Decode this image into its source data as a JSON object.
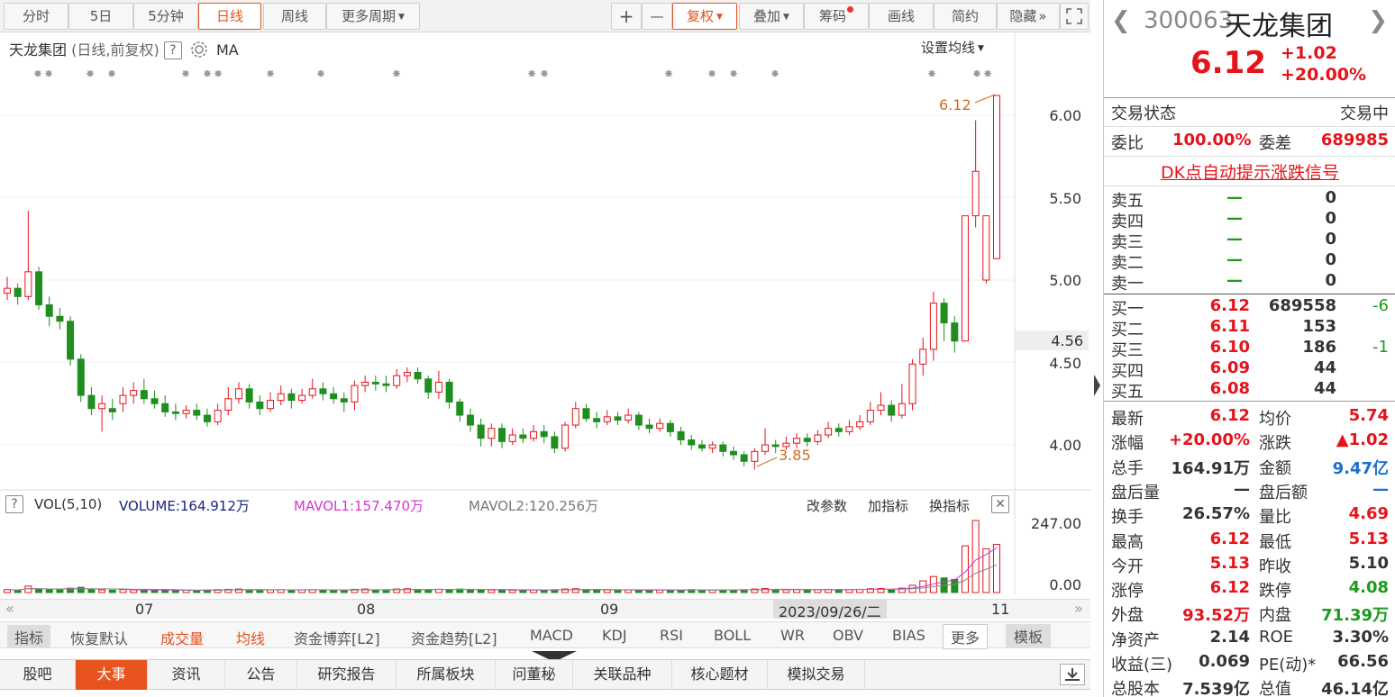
{
  "toolbar": {
    "periods": [
      "分时",
      "5日",
      "5分钟",
      "日线",
      "周线",
      "更多周期"
    ],
    "plus": "+",
    "minus": "—",
    "fuquan": "复权",
    "overlay": "叠加",
    "chips": "筹码",
    "draw": "画线",
    "simple": "简约",
    "hide": "隐藏",
    "hide_arrow": "»"
  },
  "chart": {
    "title": "天龙集团",
    "subtitle": "(日线,前复权)",
    "help": "?",
    "ma_label": "MA",
    "set_ma": "设置均线",
    "price_ticks": [
      "6.00",
      "5.50",
      "5.00",
      "4.50",
      "4.00"
    ],
    "current_price_tag": "4.56",
    "high_label": "6.12",
    "low_label": "3.85",
    "x_labels": [
      "07",
      "08",
      "09",
      "11"
    ],
    "date_tag": "2023/09/26/二",
    "vol_ticks": [
      "247.00",
      "0.00"
    ]
  },
  "indicator": {
    "help": "?",
    "name": "VOL(5,10)",
    "volume": "VOLUME:164.912万",
    "mavol1": "MAVOL1:157.470万",
    "mavol2": "MAVOL2:120.256万",
    "change_param": "改参数",
    "add_ind": "加指标",
    "swap_ind": "换指标",
    "close": "✕"
  },
  "ind_tabs": [
    "指标",
    "恢复默认",
    "成交量",
    "均线",
    "资金博弈[L2]",
    "资金趋势[L2]",
    "MACD",
    "KDJ",
    "RSI",
    "BOLL",
    "WR",
    "OBV",
    "BIAS",
    "更多",
    "模板"
  ],
  "bottom_tabs": [
    "股吧",
    "大事",
    "资讯",
    "公告",
    "研究报告",
    "所属板块",
    "问董秘",
    "关联品种",
    "核心题材",
    "模拟交易"
  ],
  "quote": {
    "code": "300063",
    "name": "天龙集团",
    "price": "6.12",
    "change": "+1.02",
    "change_pct": "+20.00%",
    "status_label": "交易状态",
    "status_value": "交易中",
    "weibi_label": "委比",
    "weibi_value": "100.00%",
    "weicha_label": "委差",
    "weicha_value": "689985",
    "dk_signal": "DK点自动提示涨跌信号",
    "asks": [
      {
        "label": "卖五",
        "price": "—",
        "vol": "0"
      },
      {
        "label": "卖四",
        "price": "—",
        "vol": "0"
      },
      {
        "label": "卖三",
        "price": "—",
        "vol": "0"
      },
      {
        "label": "卖二",
        "price": "—",
        "vol": "0"
      },
      {
        "label": "卖一",
        "price": "—",
        "vol": "0"
      }
    ],
    "bids": [
      {
        "label": "买一",
        "price": "6.12",
        "vol": "689558",
        "delta": "-6"
      },
      {
        "label": "买二",
        "price": "6.11",
        "vol": "153",
        "delta": ""
      },
      {
        "label": "买三",
        "price": "6.10",
        "vol": "186",
        "delta": "-1"
      },
      {
        "label": "买四",
        "price": "6.09",
        "vol": "44",
        "delta": ""
      },
      {
        "label": "买五",
        "price": "6.08",
        "vol": "44",
        "delta": ""
      }
    ],
    "stats": [
      {
        "l1": "最新",
        "v1": "6.12",
        "c1": "red",
        "l2": "均价",
        "v2": "5.74",
        "c2": "red"
      },
      {
        "l1": "涨幅",
        "v1": "+20.00%",
        "c1": "red",
        "l2": "涨跌",
        "v2": "▲1.02",
        "c2": "red"
      },
      {
        "l1": "总手",
        "v1": "164.91万",
        "c1": "",
        "l2": "金额",
        "v2": "9.47亿",
        "c2": "blu"
      },
      {
        "l1": "盘后量",
        "v1": "—",
        "c1": "",
        "l2": "盘后额",
        "v2": "—",
        "c2": "blu"
      },
      {
        "l1": "换手",
        "v1": "26.57%",
        "c1": "",
        "l2": "量比",
        "v2": "4.69",
        "c2": "red"
      },
      {
        "l1": "最高",
        "v1": "6.12",
        "c1": "red",
        "l2": "最低",
        "v2": "5.13",
        "c2": "red"
      },
      {
        "l1": "今开",
        "v1": "5.13",
        "c1": "red",
        "l2": "昨收",
        "v2": "5.10",
        "c2": ""
      },
      {
        "l1": "涨停",
        "v1": "6.12",
        "c1": "red",
        "l2": "跌停",
        "v2": "4.08",
        "c2": "grn"
      },
      {
        "l1": "外盘",
        "v1": "93.52万",
        "c1": "red",
        "l2": "内盘",
        "v2": "71.39万",
        "c2": "grn"
      },
      {
        "l1": "净资产",
        "v1": "2.14",
        "c1": "",
        "l2": "ROE",
        "v2": "3.30%",
        "c2": ""
      },
      {
        "l1": "收益(三)",
        "v1": "0.069",
        "c1": "",
        "l2": "PE(动)*",
        "v2": "66.56",
        "c2": ""
      },
      {
        "l1": "总股本",
        "v1": "7.539亿",
        "c1": "",
        "l2": "总值",
        "v2": "46.14亿",
        "c2": ""
      }
    ]
  },
  "colors": {
    "up": "#e5141b",
    "down": "#1f8e1f",
    "accent": "#e8541e"
  },
  "chart_data": {
    "type": "candlestick",
    "title": "天龙集团",
    "price_range": [
      3.7,
      6.4
    ],
    "candles": [
      [
        4.92,
        4.95,
        5.02,
        4.88
      ],
      [
        4.95,
        4.9,
        4.98,
        4.85
      ],
      [
        4.9,
        5.05,
        5.42,
        4.88
      ],
      [
        5.05,
        4.85,
        5.08,
        4.82
      ],
      [
        4.85,
        4.78,
        4.9,
        4.72
      ],
      [
        4.78,
        4.75,
        4.83,
        4.7
      ],
      [
        4.75,
        4.52,
        4.78,
        4.48
      ],
      [
        4.52,
        4.3,
        4.55,
        4.26
      ],
      [
        4.3,
        4.22,
        4.35,
        4.18
      ],
      [
        4.22,
        4.25,
        4.3,
        4.08
      ],
      [
        4.22,
        4.2,
        4.28,
        4.15
      ],
      [
        4.25,
        4.3,
        4.35,
        4.2
      ],
      [
        4.3,
        4.33,
        4.38,
        4.25
      ],
      [
        4.33,
        4.28,
        4.4,
        4.25
      ],
      [
        4.28,
        4.25,
        4.33,
        4.22
      ],
      [
        4.25,
        4.2,
        4.3,
        4.17
      ],
      [
        4.2,
        4.19,
        4.25,
        4.15
      ],
      [
        4.19,
        4.21,
        4.24,
        4.16
      ],
      [
        4.21,
        4.18,
        4.25,
        4.15
      ],
      [
        4.18,
        4.14,
        4.22,
        4.11
      ],
      [
        4.14,
        4.21,
        4.25,
        4.12
      ],
      [
        4.21,
        4.28,
        4.35,
        4.18
      ],
      [
        4.28,
        4.34,
        4.38,
        4.25
      ],
      [
        4.34,
        4.26,
        4.37,
        4.22
      ],
      [
        4.26,
        4.22,
        4.3,
        4.18
      ],
      [
        4.22,
        4.27,
        4.32,
        4.2
      ],
      [
        4.27,
        4.31,
        4.36,
        4.24
      ],
      [
        4.31,
        4.27,
        4.34,
        4.22
      ],
      [
        4.27,
        4.3,
        4.34,
        4.25
      ],
      [
        4.3,
        4.34,
        4.4,
        4.28
      ],
      [
        4.34,
        4.31,
        4.38,
        4.27
      ],
      [
        4.31,
        4.28,
        4.35,
        4.25
      ],
      [
        4.28,
        4.26,
        4.32,
        4.2
      ],
      [
        4.26,
        4.36,
        4.39,
        4.21
      ],
      [
        4.36,
        4.38,
        4.42,
        4.32
      ],
      [
        4.38,
        4.37,
        4.42,
        4.33
      ],
      [
        4.37,
        4.36,
        4.42,
        4.32
      ],
      [
        4.36,
        4.42,
        4.46,
        4.34
      ],
      [
        4.42,
        4.44,
        4.47,
        4.38
      ],
      [
        4.44,
        4.4,
        4.47,
        4.37
      ],
      [
        4.4,
        4.32,
        4.42,
        4.28
      ],
      [
        4.32,
        4.38,
        4.45,
        4.28
      ],
      [
        4.38,
        4.26,
        4.4,
        4.22
      ],
      [
        4.26,
        4.18,
        4.28,
        4.14
      ],
      [
        4.18,
        4.12,
        4.22,
        4.08
      ],
      [
        4.12,
        4.04,
        4.16,
        3.99
      ],
      [
        4.04,
        4.1,
        4.13,
        3.99
      ],
      [
        4.1,
        4.02,
        4.13,
        3.98
      ],
      [
        4.02,
        4.06,
        4.1,
        4.0
      ],
      [
        4.06,
        4.04,
        4.1,
        4.01
      ],
      [
        4.04,
        4.08,
        4.12,
        4.02
      ],
      [
        4.08,
        4.05,
        4.12,
        4.01
      ],
      [
        4.05,
        3.98,
        4.08,
        3.95
      ],
      [
        3.98,
        4.12,
        4.14,
        3.96
      ],
      [
        4.12,
        4.22,
        4.26,
        4.1
      ],
      [
        4.22,
        4.16,
        4.25,
        4.14
      ],
      [
        4.16,
        4.14,
        4.2,
        4.1
      ],
      [
        4.14,
        4.17,
        4.21,
        4.12
      ],
      [
        4.17,
        4.15,
        4.2,
        4.12
      ],
      [
        4.15,
        4.18,
        4.22,
        4.13
      ],
      [
        4.18,
        4.12,
        4.2,
        4.09
      ],
      [
        4.12,
        4.1,
        4.16,
        4.07
      ],
      [
        4.1,
        4.13,
        4.16,
        4.08
      ],
      [
        4.13,
        4.08,
        4.15,
        4.05
      ],
      [
        4.08,
        4.03,
        4.11,
        4.0
      ],
      [
        4.03,
        4.0,
        4.06,
        3.97
      ],
      [
        4.0,
        3.98,
        4.03,
        3.96
      ],
      [
        3.98,
        4.0,
        4.02,
        3.95
      ],
      [
        4.0,
        3.96,
        4.02,
        3.93
      ],
      [
        3.96,
        3.94,
        3.99,
        3.91
      ],
      [
        3.94,
        3.9,
        3.96,
        3.87
      ],
      [
        3.9,
        3.96,
        3.98,
        3.85
      ],
      [
        3.96,
        4.0,
        4.1,
        3.94
      ],
      [
        4.0,
        3.99,
        4.03,
        3.95
      ],
      [
        3.99,
        4.01,
        4.05,
        3.97
      ],
      [
        4.01,
        4.04,
        4.07,
        3.98
      ],
      [
        4.04,
        4.02,
        4.07,
        3.99
      ],
      [
        4.02,
        4.06,
        4.09,
        4.0
      ],
      [
        4.06,
        4.1,
        4.14,
        4.04
      ],
      [
        4.1,
        4.08,
        4.13,
        4.05
      ],
      [
        4.08,
        4.11,
        4.15,
        4.06
      ],
      [
        4.11,
        4.14,
        4.18,
        4.09
      ],
      [
        4.14,
        4.21,
        4.26,
        4.12
      ],
      [
        4.21,
        4.24,
        4.32,
        4.18
      ],
      [
        4.24,
        4.18,
        4.27,
        4.14
      ],
      [
        4.18,
        4.25,
        4.37,
        4.16
      ],
      [
        4.25,
        4.49,
        4.52,
        4.21
      ],
      [
        4.49,
        4.58,
        4.65,
        4.42
      ],
      [
        4.58,
        4.86,
        4.93,
        4.51
      ],
      [
        4.86,
        4.74,
        4.89,
        4.63
      ],
      [
        4.74,
        4.63,
        4.78,
        4.56
      ],
      [
        4.63,
        5.39,
        5.39,
        4.63
      ],
      [
        5.39,
        5.66,
        5.97,
        5.32
      ],
      [
        5.0,
        5.39,
        5.39,
        4.98
      ],
      [
        5.13,
        6.12,
        6.12,
        5.13
      ]
    ],
    "volume_range": [
      0,
      247
    ],
    "volumes": [
      10,
      8,
      22,
      12,
      10,
      9,
      15,
      18,
      12,
      9,
      8,
      10,
      9,
      10,
      8,
      8,
      7,
      8,
      7,
      9,
      10,
      11,
      12,
      9,
      8,
      9,
      10,
      8,
      9,
      10,
      9,
      8,
      8,
      11,
      12,
      9,
      9,
      12,
      13,
      10,
      9,
      11,
      10,
      12,
      11,
      10,
      9,
      9,
      8,
      8,
      9,
      8,
      10,
      12,
      13,
      10,
      9,
      9,
      8,
      9,
      8,
      8,
      9,
      8,
      9,
      10,
      8,
      9,
      8,
      9,
      10,
      12,
      14,
      10,
      9,
      10,
      9,
      10,
      11,
      10,
      10,
      11,
      13,
      14,
      11,
      15,
      25,
      40,
      55,
      50,
      45,
      160,
      247,
      150,
      165
    ],
    "last_close": 6.12,
    "period_low": 3.85
  }
}
